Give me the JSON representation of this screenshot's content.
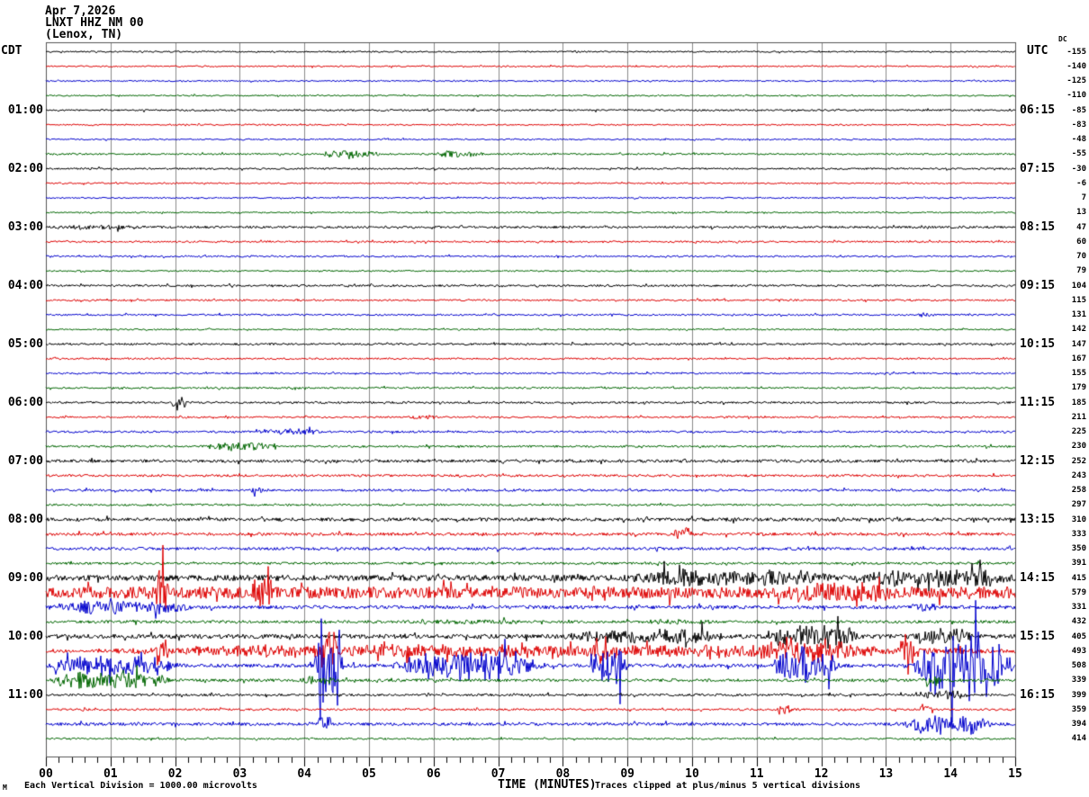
{
  "header": {
    "date": "Apr 7,2026",
    "station": "LNXT HHZ NM 00",
    "location": "(Lenox, TN)"
  },
  "left_axis": {
    "label": "CDT",
    "hour_labels": [
      {
        "row": 4,
        "text": "01:00"
      },
      {
        "row": 8,
        "text": "02:00"
      },
      {
        "row": 12,
        "text": "03:00"
      },
      {
        "row": 16,
        "text": "04:00"
      },
      {
        "row": 20,
        "text": "05:00"
      },
      {
        "row": 24,
        "text": "06:00"
      },
      {
        "row": 28,
        "text": "07:00"
      },
      {
        "row": 32,
        "text": "08:00"
      },
      {
        "row": 36,
        "text": "09:00"
      },
      {
        "row": 40,
        "text": "10:00"
      },
      {
        "row": 44,
        "text": "11:00"
      }
    ]
  },
  "right_axis": {
    "label": "UTC",
    "dc_header": "DC",
    "hour_labels": [
      {
        "row": 4,
        "text": "06:15"
      },
      {
        "row": 8,
        "text": "07:15"
      },
      {
        "row": 12,
        "text": "08:15"
      },
      {
        "row": 16,
        "text": "09:15"
      },
      {
        "row": 20,
        "text": "10:15"
      },
      {
        "row": 24,
        "text": "11:15"
      },
      {
        "row": 28,
        "text": "12:15"
      },
      {
        "row": 32,
        "text": "13:15"
      },
      {
        "row": 36,
        "text": "14:15"
      },
      {
        "row": 40,
        "text": "15:15"
      },
      {
        "row": 44,
        "text": "16:15"
      }
    ]
  },
  "footer": {
    "logo_mark": "M",
    "scale_note": "Each Vertical Division = 1000.00 microvolts",
    "clip_note": "Traces clipped at plus/minus 5 vertical divisions",
    "xaxis_title": "TIME (MINUTES)"
  },
  "chart_data": {
    "type": "line",
    "kind": "helicorder-seismogram",
    "title": "LNXT HHZ NM 00 (Lenox, TN) Apr 7,2026",
    "xlabel": "TIME (MINUTES)",
    "x_range": [
      0,
      15
    ],
    "x_ticks": [
      "00",
      "01",
      "02",
      "03",
      "04",
      "05",
      "06",
      "07",
      "08",
      "09",
      "10",
      "11",
      "12",
      "13",
      "14",
      "15"
    ],
    "minutes_per_line": 15,
    "minor_ticks_per_minute": 5,
    "clip_divisions": 5,
    "microvolts_per_division": 1000,
    "grid": true,
    "grid_color": "#8a8a8a",
    "border_color": "#555555",
    "colors": {
      "black": "#000000",
      "red": "#dd0000",
      "blue": "#0000cc",
      "green": "#006600"
    },
    "rows": [
      {
        "start_cdt": "00:00",
        "color": "black",
        "dc": -155,
        "noise": 0.05,
        "events": []
      },
      {
        "start_cdt": "00:15",
        "color": "red",
        "dc": -140,
        "noise": 0.05,
        "events": []
      },
      {
        "start_cdt": "00:30",
        "color": "blue",
        "dc": -125,
        "noise": 0.05,
        "events": []
      },
      {
        "start_cdt": "00:45",
        "color": "green",
        "dc": -110,
        "noise": 0.05,
        "events": []
      },
      {
        "start_cdt": "01:00",
        "color": "black",
        "dc": -85,
        "noise": 0.06,
        "events": []
      },
      {
        "start_cdt": "01:15",
        "color": "red",
        "dc": -83,
        "noise": 0.05,
        "events": []
      },
      {
        "start_cdt": "01:30",
        "color": "blue",
        "dc": -48,
        "noise": 0.05,
        "events": []
      },
      {
        "start_cdt": "01:45",
        "color": "green",
        "dc": -55,
        "noise": 0.06,
        "events": [
          [
            4.25,
            5.2,
            0.3
          ],
          [
            5.95,
            6.8,
            0.18
          ]
        ]
      },
      {
        "start_cdt": "02:00",
        "color": "black",
        "dc": -30,
        "noise": 0.06,
        "events": []
      },
      {
        "start_cdt": "02:15",
        "color": "red",
        "dc": -6,
        "noise": 0.05,
        "events": []
      },
      {
        "start_cdt": "02:30",
        "color": "blue",
        "dc": 7,
        "noise": 0.05,
        "events": []
      },
      {
        "start_cdt": "02:45",
        "color": "green",
        "dc": 13,
        "noise": 0.05,
        "events": []
      },
      {
        "start_cdt": "03:00",
        "color": "black",
        "dc": 47,
        "noise": 0.08,
        "events": [
          [
            0,
            1.6,
            0.1
          ]
        ]
      },
      {
        "start_cdt": "03:15",
        "color": "red",
        "dc": 60,
        "noise": 0.06,
        "events": []
      },
      {
        "start_cdt": "03:30",
        "color": "blue",
        "dc": 70,
        "noise": 0.06,
        "events": []
      },
      {
        "start_cdt": "03:45",
        "color": "green",
        "dc": 79,
        "noise": 0.05,
        "events": []
      },
      {
        "start_cdt": "04:00",
        "color": "black",
        "dc": 104,
        "noise": 0.07,
        "events": []
      },
      {
        "start_cdt": "04:15",
        "color": "red",
        "dc": 115,
        "noise": 0.06,
        "events": []
      },
      {
        "start_cdt": "04:30",
        "color": "blue",
        "dc": 131,
        "noise": 0.06,
        "events": [
          [
            13.5,
            13.75,
            0.15
          ]
        ]
      },
      {
        "start_cdt": "04:45",
        "color": "green",
        "dc": 142,
        "noise": 0.05,
        "events": []
      },
      {
        "start_cdt": "05:00",
        "color": "black",
        "dc": 147,
        "noise": 0.07,
        "events": []
      },
      {
        "start_cdt": "05:15",
        "color": "red",
        "dc": 167,
        "noise": 0.06,
        "events": []
      },
      {
        "start_cdt": "05:30",
        "color": "blue",
        "dc": 155,
        "noise": 0.06,
        "events": []
      },
      {
        "start_cdt": "05:45",
        "color": "green",
        "dc": 179,
        "noise": 0.06,
        "events": []
      },
      {
        "start_cdt": "06:00",
        "color": "black",
        "dc": 185,
        "noise": 0.07,
        "events": [
          [
            1.95,
            2.2,
            0.5
          ]
        ]
      },
      {
        "start_cdt": "06:15",
        "color": "red",
        "dc": 211,
        "noise": 0.06,
        "events": [
          [
            5.6,
            6.1,
            0.12
          ]
        ]
      },
      {
        "start_cdt": "06:30",
        "color": "blue",
        "dc": 225,
        "noise": 0.07,
        "events": [
          [
            3.2,
            4.3,
            0.16
          ]
        ]
      },
      {
        "start_cdt": "06:45",
        "color": "green",
        "dc": 230,
        "noise": 0.07,
        "events": [
          [
            2.4,
            3.6,
            0.25
          ]
        ]
      },
      {
        "start_cdt": "07:00",
        "color": "black",
        "dc": 252,
        "noise": 0.1,
        "events": []
      },
      {
        "start_cdt": "07:15",
        "color": "red",
        "dc": 243,
        "noise": 0.08,
        "events": []
      },
      {
        "start_cdt": "07:30",
        "color": "blue",
        "dc": 258,
        "noise": 0.08,
        "events": [
          [
            3.15,
            3.45,
            0.18
          ]
        ]
      },
      {
        "start_cdt": "07:45",
        "color": "green",
        "dc": 297,
        "noise": 0.07,
        "events": []
      },
      {
        "start_cdt": "08:00",
        "color": "black",
        "dc": 310,
        "noise": 0.12,
        "events": []
      },
      {
        "start_cdt": "08:15",
        "color": "red",
        "dc": 333,
        "noise": 0.1,
        "events": [
          [
            9.65,
            10.0,
            0.5
          ]
        ]
      },
      {
        "start_cdt": "08:30",
        "color": "blue",
        "dc": 350,
        "noise": 0.1,
        "events": []
      },
      {
        "start_cdt": "08:45",
        "color": "green",
        "dc": 391,
        "noise": 0.08,
        "events": []
      },
      {
        "start_cdt": "09:00",
        "color": "black",
        "dc": 415,
        "noise": 0.2,
        "events": [
          [
            8.9,
            12.3,
            0.45
          ],
          [
            12.6,
            15,
            0.5
          ]
        ]
      },
      {
        "start_cdt": "09:15",
        "color": "red",
        "dc": 579,
        "noise": 0.4,
        "events": [
          [
            1.7,
            1.9,
            1.6
          ],
          [
            3.15,
            3.55,
            0.7
          ],
          [
            11.3,
            13.2,
            0.35
          ]
        ]
      },
      {
        "start_cdt": "09:30",
        "color": "blue",
        "dc": 331,
        "noise": 0.12,
        "events": [
          [
            0,
            2.3,
            0.4
          ],
          [
            13.35,
            13.85,
            0.2
          ]
        ]
      },
      {
        "start_cdt": "09:45",
        "color": "green",
        "dc": 432,
        "noise": 0.1,
        "events": [
          [
            5.4,
            7.6,
            0.08
          ],
          [
            9.2,
            10.4,
            0.1
          ]
        ]
      },
      {
        "start_cdt": "10:00",
        "color": "black",
        "dc": 405,
        "noise": 0.15,
        "events": [
          [
            8.0,
            10.6,
            0.45
          ],
          [
            11.15,
            12.6,
            1.0
          ],
          [
            13.4,
            14.35,
            0.65
          ]
        ]
      },
      {
        "start_cdt": "10:15",
        "color": "red",
        "dc": 493,
        "noise": 0.1,
        "events": [
          [
            0.65,
            15,
            0.42
          ],
          [
            1.7,
            1.9,
            1.1
          ],
          [
            4.25,
            4.5,
            1.4
          ],
          [
            8.5,
            8.75,
            1.5
          ],
          [
            11.0,
            12.5,
            0.5
          ],
          [
            13.2,
            13.45,
            1.6
          ]
        ]
      },
      {
        "start_cdt": "10:30",
        "color": "blue",
        "dc": 508,
        "noise": 0.12,
        "events": [
          [
            0,
            2.1,
            0.75
          ],
          [
            4.15,
            4.6,
            4.8
          ],
          [
            5.3,
            7.75,
            1.0
          ],
          [
            8.4,
            9.05,
            1.4
          ],
          [
            11.2,
            12.35,
            1.2
          ],
          [
            13.4,
            15,
            2.4
          ]
        ]
      },
      {
        "start_cdt": "10:45",
        "color": "green",
        "dc": 339,
        "noise": 0.1,
        "events": [
          [
            0,
            2.0,
            0.6
          ],
          [
            3.9,
            4.5,
            0.25
          ],
          [
            13.55,
            13.85,
            0.35
          ]
        ]
      },
      {
        "start_cdt": "11:00",
        "color": "black",
        "dc": 399,
        "noise": 0.08,
        "events": [
          [
            13.45,
            14.3,
            0.28
          ]
        ]
      },
      {
        "start_cdt": "11:15",
        "color": "red",
        "dc": 359,
        "noise": 0.07,
        "events": [
          [
            11.3,
            11.55,
            0.3
          ],
          [
            13.5,
            13.75,
            0.35
          ]
        ]
      },
      {
        "start_cdt": "11:30",
        "color": "blue",
        "dc": 394,
        "noise": 0.1,
        "events": [
          [
            4.2,
            4.45,
            0.7
          ],
          [
            13.25,
            14.65,
            0.8
          ]
        ]
      },
      {
        "start_cdt": "11:45",
        "color": "green",
        "dc": 414,
        "noise": 0.06,
        "events": []
      }
    ]
  }
}
